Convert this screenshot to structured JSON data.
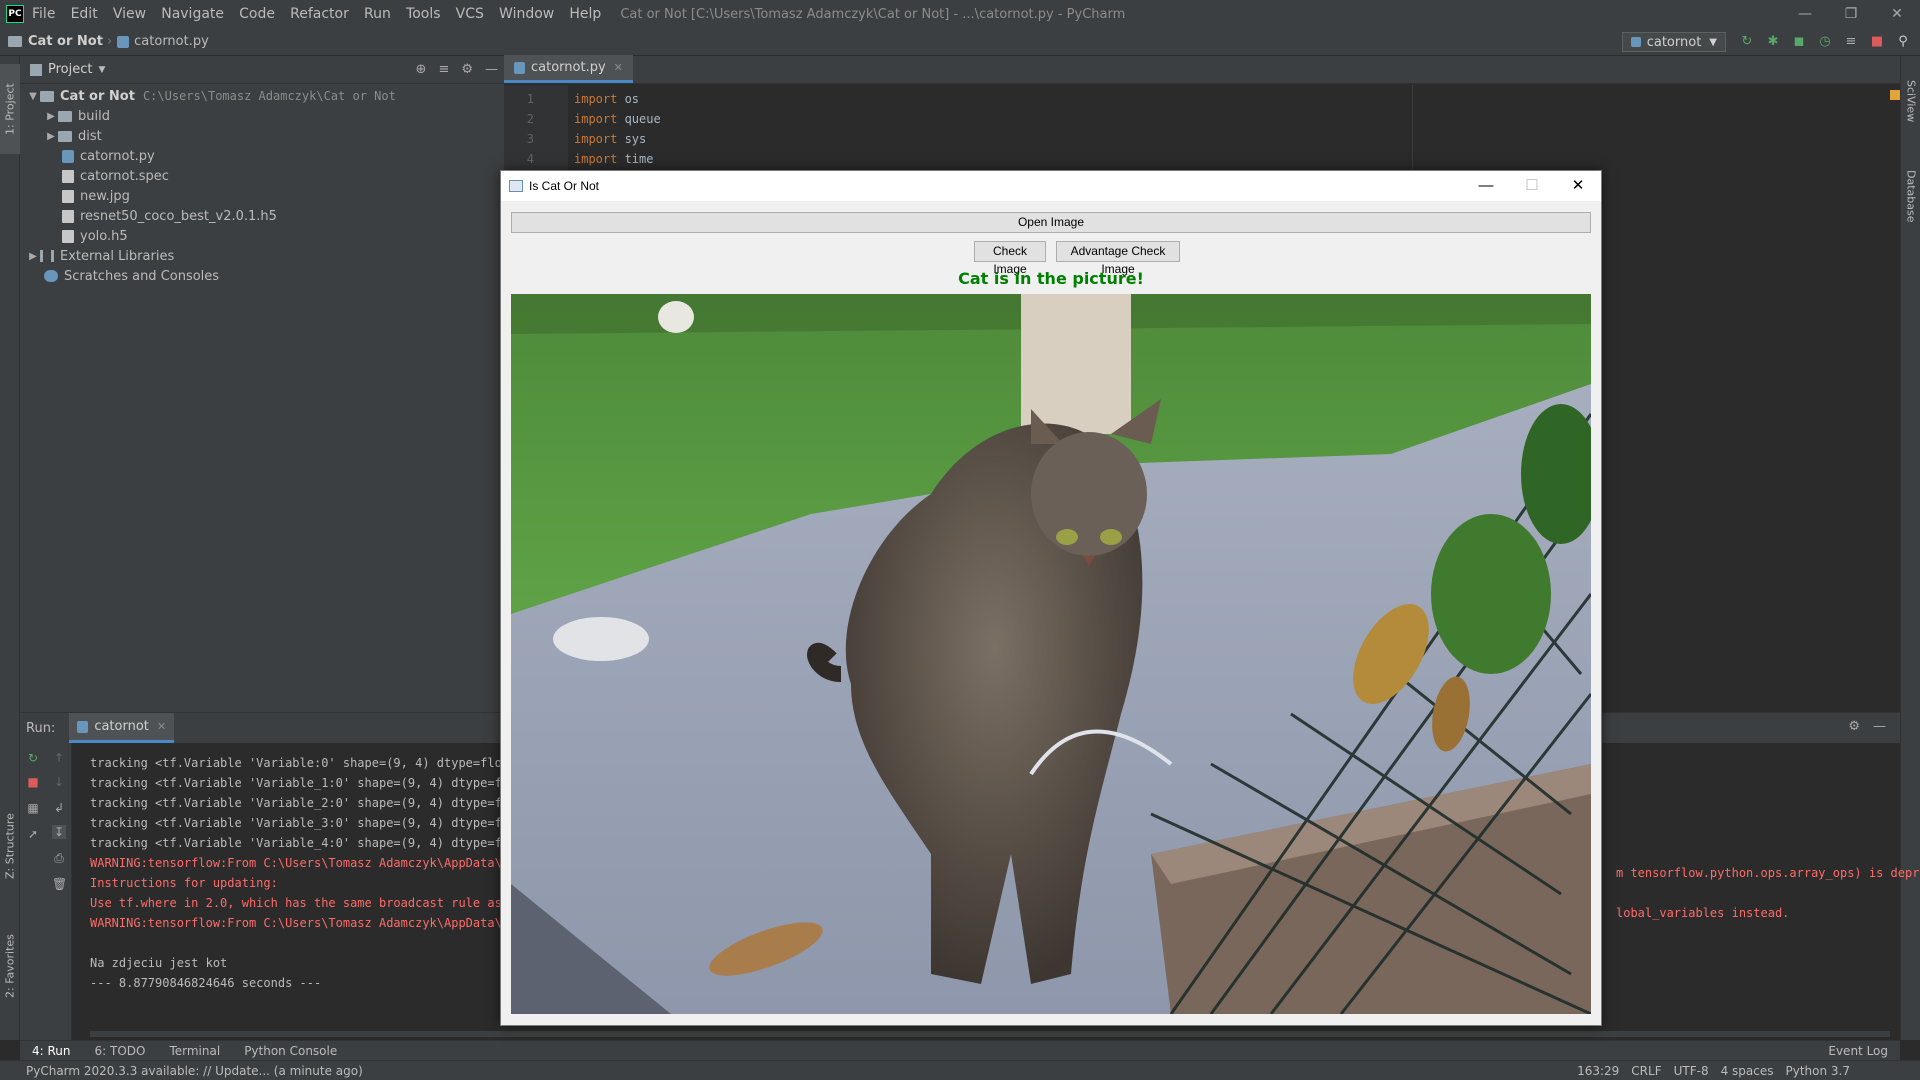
{
  "window": {
    "logo": "PC",
    "menu": [
      "File",
      "Edit",
      "View",
      "Navigate",
      "Code",
      "Refactor",
      "Run",
      "Tools",
      "VCS",
      "Window",
      "Help"
    ],
    "title": "Cat or Not [C:\\Users\\Tomasz Adamczyk\\Cat or Not] - ...\\catornot.py - PyCharm"
  },
  "navbar": {
    "project": "Cat or Not",
    "file": "catornot.py",
    "run_config": "catornot"
  },
  "side_tabs": {
    "project": "1: Project",
    "structure": "Z: Structure",
    "favorites": "2: Favorites",
    "sciview": "SciView",
    "database": "Database"
  },
  "project_panel": {
    "title": "Project",
    "root": {
      "name": "Cat or Not",
      "path": "C:\\Users\\Tomasz Adamczyk\\Cat or Not"
    },
    "items": [
      {
        "name": "build",
        "kind": "folder"
      },
      {
        "name": "dist",
        "kind": "folder"
      },
      {
        "name": "catornot.py",
        "kind": "py"
      },
      {
        "name": "catornot.spec",
        "kind": "file"
      },
      {
        "name": "new.jpg",
        "kind": "file"
      },
      {
        "name": "resnet50_coco_best_v2.0.1.h5",
        "kind": "file"
      },
      {
        "name": "yolo.h5",
        "kind": "file"
      }
    ],
    "external": "External Libraries",
    "scratches": "Scratches and Consoles"
  },
  "editor": {
    "tab": "catornot.py",
    "lines": [
      {
        "n": "1",
        "kw": "import",
        "rest": " os"
      },
      {
        "n": "2",
        "kw": "import",
        "rest": " queue"
      },
      {
        "n": "3",
        "kw": "import",
        "rest": " sys"
      },
      {
        "n": "4",
        "kw": "import",
        "rest": " time"
      }
    ]
  },
  "run_panel": {
    "label": "Run:",
    "tab": "catornot",
    "output": [
      {
        "text": "tracking <tf.Variable 'Variable:0' shape=(9, 4) dtype=float",
        "style": "normal"
      },
      {
        "text": "tracking <tf.Variable 'Variable_1:0' shape=(9, 4) dtype=flo",
        "style": "normal"
      },
      {
        "text": "tracking <tf.Variable 'Variable_2:0' shape=(9, 4) dtype=flo",
        "style": "normal"
      },
      {
        "text": "tracking <tf.Variable 'Variable_3:0' shape=(9, 4) dtype=flo",
        "style": "normal"
      },
      {
        "text": "tracking <tf.Variable 'Variable_4:0' shape=(9, 4) dtype=flo",
        "style": "normal"
      },
      {
        "text": "WARNING:tensorflow:From C:\\Users\\Tomasz Adamczyk\\AppData\\Lo",
        "style": "error"
      },
      {
        "text": "Instructions for updating:",
        "style": "error"
      },
      {
        "text": "Use tf.where in 2.0, which has the same broadcast rule as n",
        "style": "error"
      },
      {
        "text": "WARNING:tensorflow:From C:\\Users\\Tomasz Adamczyk\\AppData\\Lo",
        "style": "error"
      },
      {
        "text": "",
        "style": "normal"
      },
      {
        "text": "Na zdjeciu jest kot",
        "style": "normal"
      },
      {
        "text": "--- 8.87790846824646 seconds ---",
        "style": "normal"
      }
    ],
    "right_fragments": [
      {
        "text": "m tensorflow.python.ops.array_ops) is depre",
        "style": "error"
      },
      {
        "text": "lobal_variables instead.",
        "style": "error"
      }
    ]
  },
  "bottom_tabs": [
    "4: Run",
    "6: TODO",
    "Terminal",
    "Python Console"
  ],
  "event_log": "Event Log",
  "status": {
    "message": "PyCharm 2020.3.3 available: // Update... (a minute ago)",
    "position": "163:29",
    "line_sep": "CRLF",
    "encoding": "UTF-8",
    "indent": "4 spaces",
    "interpreter": "Python 3.7"
  },
  "dialog": {
    "title": "Is Cat Or Not",
    "open_button": "Open Image",
    "check_button": "Check Image",
    "advantage_button": "Advantage Check Image",
    "result": "Cat is in the picture!"
  },
  "colors": {
    "result": "#008000",
    "error_text": "#ff6b68",
    "keyword": "#cc7832",
    "ide_bg": "#2b2b2b"
  }
}
